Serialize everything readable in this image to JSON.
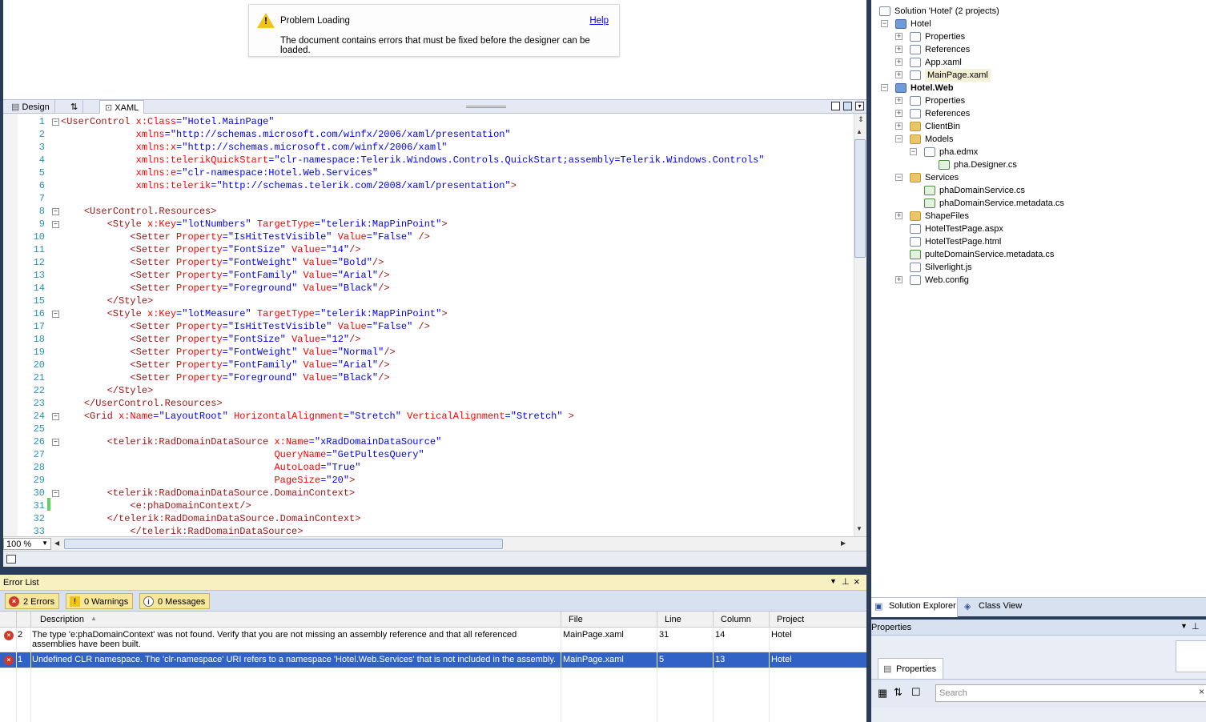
{
  "designer": {
    "banner_title": "Problem Loading",
    "help_link": "Help",
    "banner_message": "The document contains errors that must be fixed before the designer can be loaded."
  },
  "view_tabs": {
    "design": "Design",
    "swap": "⇅",
    "xaml": "XAML"
  },
  "editor": {
    "lines": [
      {
        "n": "1",
        "fold": "−",
        "html": "<span class=tag>&lt;UserControl</span> <span class=attr>x:Class</span><span class=p>=</span><span class=val>\"Hotel.MainPage\"</span>"
      },
      {
        "n": "2",
        "fold": "",
        "html": "             <span class=attr>xmlns</span><span class=p>=</span><span class=val>\"http://schemas.microsoft.com/winfx/2006/xaml/presentation\"</span>"
      },
      {
        "n": "3",
        "fold": "",
        "html": "             <span class=attr>xmlns:x</span><span class=p>=</span><span class=val>\"http://schemas.microsoft.com/winfx/2006/xaml\"</span>"
      },
      {
        "n": "4",
        "fold": "",
        "html": "             <span class=attr>xmlns:telerikQuickStart</span><span class=p>=</span><span class=val>\"clr-namespace:Telerik.Windows.Controls.QuickStart;assembly=Telerik.Windows.Controls\"</span>"
      },
      {
        "n": "5",
        "fold": "",
        "html": "             <span class=attr>xmlns:e</span><span class=p>=</span><span class=val>\"clr-namespace:Hotel.Web.Services\"</span>"
      },
      {
        "n": "6",
        "fold": "",
        "html": "             <span class=attr>xmlns:telerik</span><span class=p>=</span><span class=val>\"http://schemas.telerik.com/2008/xaml/presentation\"</span><span class=tag>&gt;</span>"
      },
      {
        "n": "7",
        "fold": "",
        "html": ""
      },
      {
        "n": "8",
        "fold": "−",
        "html": "    <span class=tag>&lt;UserControl.Resources&gt;</span>"
      },
      {
        "n": "9",
        "fold": "−",
        "html": "        <span class=tag>&lt;Style</span> <span class=attr>x:Key</span><span class=p>=</span><span class=val>\"lotNumbers\"</span> <span class=attr>TargetType</span><span class=p>=</span><span class=val>\"telerik:MapPinPoint\"</span><span class=tag>&gt;</span>"
      },
      {
        "n": "10",
        "fold": "",
        "html": "            <span class=tag>&lt;Setter</span> <span class=attr>Property</span><span class=p>=</span><span class=val>\"IsHitTestVisible\"</span> <span class=attr>Value</span><span class=p>=</span><span class=val>\"False\"</span> <span class=tag>/&gt;</span>"
      },
      {
        "n": "11",
        "fold": "",
        "html": "            <span class=tag>&lt;Setter</span> <span class=attr>Property</span><span class=p>=</span><span class=val>\"FontSize\"</span> <span class=attr>Value</span><span class=p>=</span><span class=val>\"14\"</span><span class=tag>/&gt;</span>"
      },
      {
        "n": "12",
        "fold": "",
        "html": "            <span class=tag>&lt;Setter</span> <span class=attr>Property</span><span class=p>=</span><span class=val>\"FontWeight\"</span> <span class=attr>Value</span><span class=p>=</span><span class=val>\"Bold\"</span><span class=tag>/&gt;</span>"
      },
      {
        "n": "13",
        "fold": "",
        "html": "            <span class=tag>&lt;Setter</span> <span class=attr>Property</span><span class=p>=</span><span class=val>\"FontFamily\"</span> <span class=attr>Value</span><span class=p>=</span><span class=val>\"Arial\"</span><span class=tag>/&gt;</span>"
      },
      {
        "n": "14",
        "fold": "",
        "html": "            <span class=tag>&lt;Setter</span> <span class=attr>Property</span><span class=p>=</span><span class=val>\"Foreground\"</span> <span class=attr>Value</span><span class=p>=</span><span class=val>\"Black\"</span><span class=tag>/&gt;</span>"
      },
      {
        "n": "15",
        "fold": "",
        "html": "        <span class=tag>&lt;/Style&gt;</span>"
      },
      {
        "n": "16",
        "fold": "−",
        "html": "        <span class=tag>&lt;Style</span> <span class=attr>x:Key</span><span class=p>=</span><span class=val>\"lotMeasure\"</span> <span class=attr>TargetType</span><span class=p>=</span><span class=val>\"telerik:MapPinPoint\"</span><span class=tag>&gt;</span>"
      },
      {
        "n": "17",
        "fold": "",
        "html": "            <span class=tag>&lt;Setter</span> <span class=attr>Property</span><span class=p>=</span><span class=val>\"IsHitTestVisible\"</span> <span class=attr>Value</span><span class=p>=</span><span class=val>\"False\"</span> <span class=tag>/&gt;</span>"
      },
      {
        "n": "18",
        "fold": "",
        "html": "            <span class=tag>&lt;Setter</span> <span class=attr>Property</span><span class=p>=</span><span class=val>\"FontSize\"</span> <span class=attr>Value</span><span class=p>=</span><span class=val>\"12\"</span><span class=tag>/&gt;</span>"
      },
      {
        "n": "19",
        "fold": "",
        "html": "            <span class=tag>&lt;Setter</span> <span class=attr>Property</span><span class=p>=</span><span class=val>\"FontWeight\"</span> <span class=attr>Value</span><span class=p>=</span><span class=val>\"Normal\"</span><span class=tag>/&gt;</span>"
      },
      {
        "n": "20",
        "fold": "",
        "html": "            <span class=tag>&lt;Setter</span> <span class=attr>Property</span><span class=p>=</span><span class=val>\"FontFamily\"</span> <span class=attr>Value</span><span class=p>=</span><span class=val>\"Arial\"</span><span class=tag>/&gt;</span>"
      },
      {
        "n": "21",
        "fold": "",
        "html": "            <span class=tag>&lt;Setter</span> <span class=attr>Property</span><span class=p>=</span><span class=val>\"Foreground\"</span> <span class=attr>Value</span><span class=p>=</span><span class=val>\"Black\"</span><span class=tag>/&gt;</span>"
      },
      {
        "n": "22",
        "fold": "",
        "html": "        <span class=tag>&lt;/Style&gt;</span>"
      },
      {
        "n": "23",
        "fold": "",
        "html": "    <span class=tag>&lt;/UserControl.Resources&gt;</span>"
      },
      {
        "n": "24",
        "fold": "−",
        "html": "    <span class=tag>&lt;Grid</span> <span class=attr>x:Name</span><span class=p>=</span><span class=val>\"LayoutRoot\"</span> <span class=attr>HorizontalAlignment</span><span class=p>=</span><span class=val>\"Stretch\"</span> <span class=attr>VerticalAlignment</span><span class=p>=</span><span class=val>\"Stretch\"</span> <span class=tag>&gt;</span>"
      },
      {
        "n": "25",
        "fold": "",
        "html": ""
      },
      {
        "n": "26",
        "fold": "−",
        "html": "        <span class=tag>&lt;telerik:RadDomainDataSource</span> <span class=attr>x:Name</span><span class=p>=</span><span class=val>\"xRadDomainDataSource\"</span>"
      },
      {
        "n": "27",
        "fold": "",
        "html": "                                     <span class=attr>QueryName</span><span class=p>=</span><span class=val>\"GetPultesQuery\"</span>"
      },
      {
        "n": "28",
        "fold": "",
        "html": "                                     <span class=attr>AutoLoad</span><span class=p>=</span><span class=val>\"True\"</span>"
      },
      {
        "n": "29",
        "fold": "",
        "html": "                                     <span class=attr>PageSize</span><span class=p>=</span><span class=val>\"20\"</span><span class=tag>&gt;</span>"
      },
      {
        "n": "30",
        "fold": "−",
        "html": "        <span class=tag>&lt;telerik:RadDomainDataSource.DomainContext&gt;</span>"
      },
      {
        "n": "31",
        "fold": "",
        "html": "            <span class=tag>&lt;e:phaDomainContext/&gt;</span>"
      },
      {
        "n": "32",
        "fold": "",
        "html": "        <span class=tag>&lt;/telerik:RadDomainDataSource.DomainContext&gt;</span>"
      },
      {
        "n": "33",
        "fold": "",
        "html": "            <span class=tag>&lt;/telerik:RadDomainDataSource&gt;</span>"
      }
    ],
    "zoom": "100 %"
  },
  "error_list": {
    "title": "Error List",
    "errors_btn": "2 Errors",
    "warnings_btn": "0 Warnings",
    "messages_btn": "0 Messages",
    "columns": [
      "Description",
      "File",
      "Line",
      "Column",
      "Project"
    ],
    "rows": [
      {
        "num": "2",
        "desc": "The type 'e:phaDomainContext' was not found. Verify that you are not missing an assembly reference and that all referenced assemblies have been built.",
        "file": "MainPage.xaml",
        "line": "31",
        "column": "14",
        "project": "Hotel"
      },
      {
        "num": "1",
        "desc": "Undefined CLR namespace. The 'clr-namespace' URI refers to a namespace 'Hotel.Web.Services' that is not included in the assembly.",
        "file": "MainPage.xaml",
        "line": "5",
        "column": "13",
        "project": "Hotel"
      }
    ]
  },
  "solution": {
    "nodes": [
      {
        "label": "Solution 'Hotel' (2 projects)",
        "depth": 0,
        "exp": "",
        "icon": "file"
      },
      {
        "label": "Hotel",
        "depth": 1,
        "exp": "−",
        "icon": "proj"
      },
      {
        "label": "Properties",
        "depth": 2,
        "exp": "+",
        "icon": "file"
      },
      {
        "label": "References",
        "depth": 2,
        "exp": "+",
        "icon": "file"
      },
      {
        "label": "App.xaml",
        "depth": 2,
        "exp": "+",
        "icon": "file"
      },
      {
        "label": "MainPage.xaml",
        "depth": 2,
        "exp": "+",
        "icon": "file",
        "sel": true
      },
      {
        "label": "Hotel.Web",
        "depth": 1,
        "exp": "−",
        "icon": "proj",
        "bold": true
      },
      {
        "label": "Properties",
        "depth": 2,
        "exp": "+",
        "icon": "file"
      },
      {
        "label": "References",
        "depth": 2,
        "exp": "+",
        "icon": "file"
      },
      {
        "label": "ClientBin",
        "depth": 2,
        "exp": "+",
        "icon": "folder"
      },
      {
        "label": "Models",
        "depth": 2,
        "exp": "−",
        "icon": "folder"
      },
      {
        "label": "pha.edmx",
        "depth": 3,
        "exp": "−",
        "icon": "file"
      },
      {
        "label": "pha.Designer.cs",
        "depth": 4,
        "exp": "",
        "icon": "cs"
      },
      {
        "label": "Services",
        "depth": 2,
        "exp": "−",
        "icon": "folder"
      },
      {
        "label": "phaDomainService.cs",
        "depth": 3,
        "exp": "",
        "icon": "cs"
      },
      {
        "label": "phaDomainService.metadata.cs",
        "depth": 3,
        "exp": "",
        "icon": "cs"
      },
      {
        "label": "ShapeFiles",
        "depth": 2,
        "exp": "+",
        "icon": "folder"
      },
      {
        "label": "HotelTestPage.aspx",
        "depth": 2,
        "exp": "",
        "icon": "file"
      },
      {
        "label": "HotelTestPage.html",
        "depth": 2,
        "exp": "",
        "icon": "file"
      },
      {
        "label": "pulteDomainService.metadata.cs",
        "depth": 2,
        "exp": "",
        "icon": "cs"
      },
      {
        "label": "Silverlight.js",
        "depth": 2,
        "exp": "",
        "icon": "file"
      },
      {
        "label": "Web.config",
        "depth": 2,
        "exp": "+",
        "icon": "file"
      }
    ],
    "tab_solution": "Solution Explorer",
    "tab_class": "Class View"
  },
  "properties": {
    "title": "Properties",
    "tab": "Properties",
    "search_placeholder": "Search",
    "pin": "⊥",
    "close": "×"
  },
  "colors": {
    "accent": "#3163c6",
    "code_val": "#0000ff",
    "code_tag": "#a31515",
    "code_attr": "#ff0000"
  }
}
